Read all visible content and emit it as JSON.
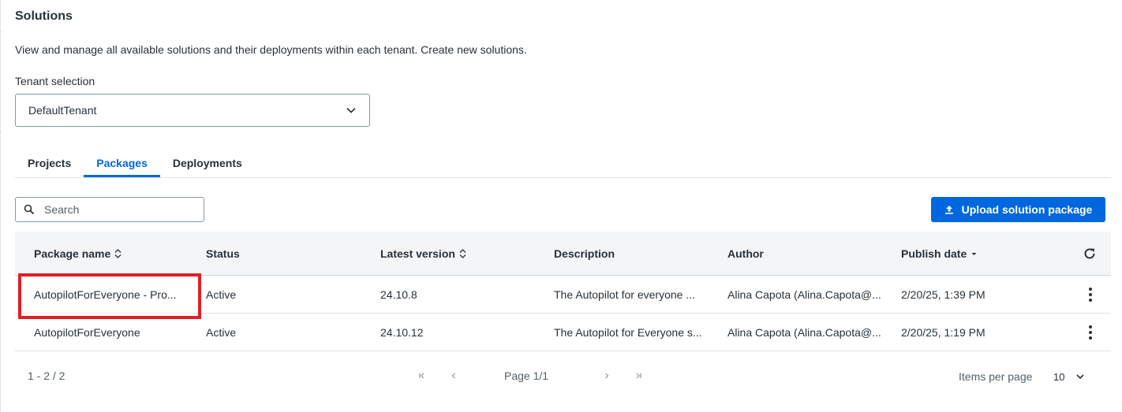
{
  "header": {
    "title": "Solutions",
    "subtitle": "View and manage all available solutions and their deployments within each tenant. Create new solutions."
  },
  "tenant": {
    "label": "Tenant selection",
    "value": "DefaultTenant"
  },
  "tabs": [
    {
      "label": "Projects",
      "active": false
    },
    {
      "label": "Packages",
      "active": true
    },
    {
      "label": "Deployments",
      "active": false
    }
  ],
  "search": {
    "placeholder": "Search"
  },
  "toolbar": {
    "upload_label": "Upload solution package"
  },
  "table": {
    "columns": [
      "Package name",
      "Status",
      "Latest version",
      "Description",
      "Author",
      "Publish date"
    ],
    "rows": [
      [
        "AutopilotForEveryone - Pro...",
        "Active",
        "24.10.8",
        "The Autopilot for everyone ...",
        "Alina Capota (Alina.Capota@...",
        "2/20/25, 1:39 PM"
      ],
      [
        "AutopilotForEveryone",
        "Active",
        "24.10.12",
        "The Autopilot for Everyone s...",
        "Alina Capota (Alina.Capota@...",
        "2/20/25, 1:19 PM"
      ]
    ]
  },
  "pager": {
    "range": "1 - 2 / 2",
    "page": "Page 1/1",
    "items_per_page_label": "Items per page",
    "items_per_page": "10"
  },
  "colors": {
    "accent": "#0067df",
    "highlight": "#e01f26"
  }
}
